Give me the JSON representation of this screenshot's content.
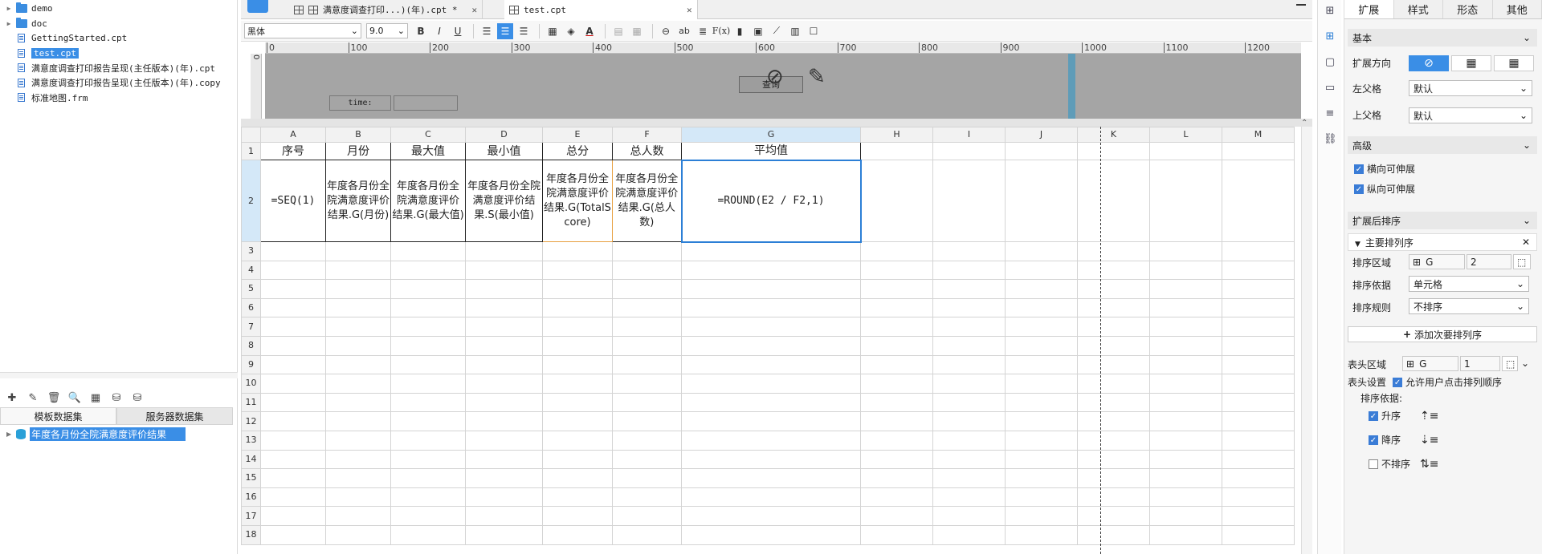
{
  "file_tree": [
    {
      "type": "folder",
      "name": "demo",
      "expandable": true
    },
    {
      "type": "folder",
      "name": "doc",
      "expandable": true
    },
    {
      "type": "file",
      "name": "GettingStarted.cpt"
    },
    {
      "type": "file",
      "name": "test.cpt",
      "selected": true
    },
    {
      "type": "file",
      "name": "满意度调查打印报告呈现(主任版本)(年).cpt"
    },
    {
      "type": "file",
      "name": "满意度调查打印报告呈现(主任版本)(年).copy"
    },
    {
      "type": "file",
      "name": "标准地图.frm"
    }
  ],
  "dataset_tabs": [
    "模板数据集",
    "服务器数据集"
  ],
  "dataset_item": "年度各月份全院满意度评价结果",
  "doc_tabs": [
    {
      "label": "满意度调查打印...)(年).cpt *",
      "active": false,
      "close": "✕"
    },
    {
      "label": "test.cpt",
      "active": true,
      "close": "✕"
    }
  ],
  "toolbar": {
    "font": "黑体",
    "size": "9.0",
    "bold": "B",
    "italic": "I",
    "underline": "U",
    "text_ab": "ab",
    "fx": "F(x)"
  },
  "ruler_marks": [
    "0",
    "100",
    "200",
    "300",
    "400",
    "500",
    "600",
    "700",
    "800",
    "900",
    "1000",
    "1100",
    "1200"
  ],
  "vruler_mark": "0",
  "param_pane": {
    "query_button": "查询",
    "time_label": "time:"
  },
  "columns": [
    "A",
    "B",
    "C",
    "D",
    "E",
    "F",
    "G",
    "H",
    "I",
    "J",
    "K",
    "L",
    "M"
  ],
  "rows": [
    "1",
    "2",
    "3",
    "4",
    "5",
    "6",
    "7",
    "8",
    "9",
    "10",
    "11",
    "12",
    "13",
    "14",
    "15",
    "16",
    "17",
    "18"
  ],
  "header_row": [
    "序号",
    "月份",
    "最大值",
    "最小值",
    "总分",
    "总人数",
    "平均值"
  ],
  "data_row": [
    "=SEQ(1)",
    "年度各月份全院满意度评价结果.G(月份)",
    "年度各月份全院满意度评价结果.G(最大值)",
    "年度各月份全院满意度评价结果.S(最小值)",
    "年度各月份全院满意度评价结果.G(TotalScore)",
    "年度各月份全院满意度评价结果.G(总人数)",
    "=ROUND(E2 / F2,1)"
  ],
  "right_tabs": [
    "扩展",
    "样式",
    "形态",
    "其他"
  ],
  "panel": {
    "basic_title": "基本",
    "expand_dir_label": "扩展方向",
    "left_parent_label": "左父格",
    "left_parent_value": "默认",
    "up_parent_label": "上父格",
    "up_parent_value": "默认",
    "advanced_title": "高级",
    "h_extend": "横向可伸展",
    "v_extend": "纵向可伸展",
    "sort_title": "扩展后排序",
    "primary_sort": "主要排列序",
    "sort_area_label": "排序区域",
    "sort_area_cell": "G",
    "sort_area_row": "2",
    "sort_by_label": "排序依据",
    "sort_by_value": "单元格",
    "sort_rule_label": "排序规则",
    "sort_rule_value": "不排序",
    "add_sort": "添加次要排列序",
    "header_area_label": "表头区域",
    "header_area_cell": "G",
    "header_area_row": "1",
    "header_setting_label": "表头设置",
    "allow_user_sort": "允许用户点击排列顺序",
    "sort_basis": "排序依据:",
    "asc": "升序",
    "desc": "降序",
    "nosort": "不排序"
  }
}
